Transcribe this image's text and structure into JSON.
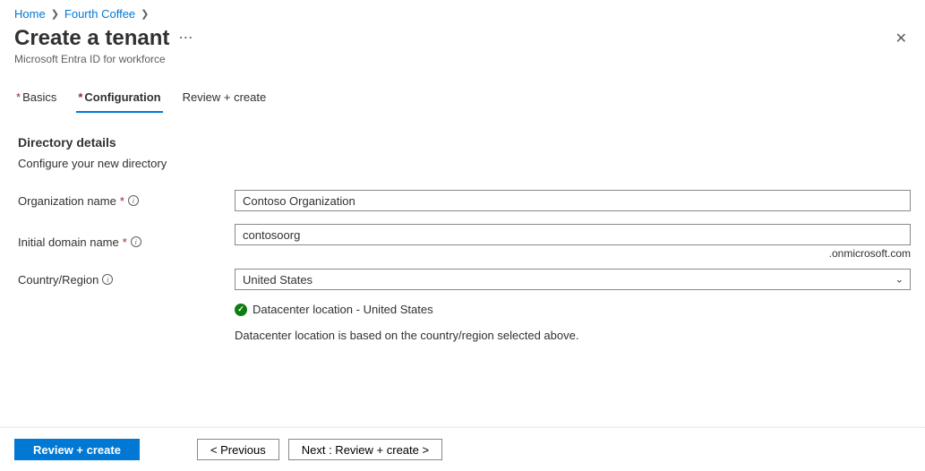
{
  "breadcrumb": {
    "home": "Home",
    "parent": "Fourth Coffee"
  },
  "header": {
    "title": "Create a tenant",
    "subtitle": "Microsoft Entra ID for workforce"
  },
  "tabs": {
    "basics": "Basics",
    "configuration": "Configuration",
    "review": "Review + create"
  },
  "section": {
    "title": "Directory details",
    "desc": "Configure your new directory"
  },
  "fields": {
    "org_label": "Organization name",
    "org_value": "Contoso Organization",
    "domain_label": "Initial domain name",
    "domain_value": "contosoorg",
    "domain_suffix": ".onmicrosoft.com",
    "country_label": "Country/Region",
    "country_value": "United States"
  },
  "datacenter": {
    "location": "Datacenter location - United States",
    "note": "Datacenter location is based on the country/region selected above."
  },
  "footer": {
    "review": "Review + create",
    "previous": "< Previous",
    "next": "Next : Review + create >"
  }
}
